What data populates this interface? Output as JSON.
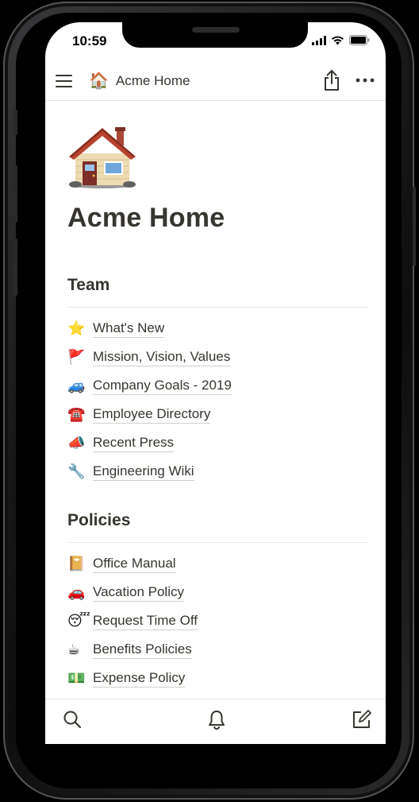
{
  "status": {
    "time": "10:59"
  },
  "topbar": {
    "page_emoji": "🏠",
    "title": "Acme Home"
  },
  "page": {
    "title": "Acme Home"
  },
  "sections": [
    {
      "heading": "Team",
      "items": [
        {
          "emoji": "⭐",
          "label": "What's New"
        },
        {
          "emoji": "🚩",
          "label": "Mission, Vision, Values"
        },
        {
          "emoji": "🚙",
          "label": "Company Goals - 2019"
        },
        {
          "emoji": "☎️",
          "label": "Employee Directory"
        },
        {
          "emoji": "📣",
          "label": "Recent Press"
        },
        {
          "emoji": "🔧",
          "label": "Engineering Wiki"
        }
      ]
    },
    {
      "heading": "Policies",
      "items": [
        {
          "emoji": "📔",
          "label": "Office Manual"
        },
        {
          "emoji": "🚗",
          "label": "Vacation Policy"
        },
        {
          "emoji": "😴",
          "label": "Request Time Off"
        },
        {
          "emoji": "☕",
          "label": "Benefits Policies"
        },
        {
          "emoji": "💵",
          "label": "Expense Policy"
        }
      ]
    }
  ],
  "icons": {
    "menu": "menu-icon",
    "share": "share-icon",
    "more": "more-icon",
    "search": "search-icon",
    "notifications": "bell-icon",
    "new_page": "compose-icon"
  },
  "colors": {
    "text": "#37352f",
    "divider": "#e9e9e7",
    "background": "#ffffff"
  }
}
